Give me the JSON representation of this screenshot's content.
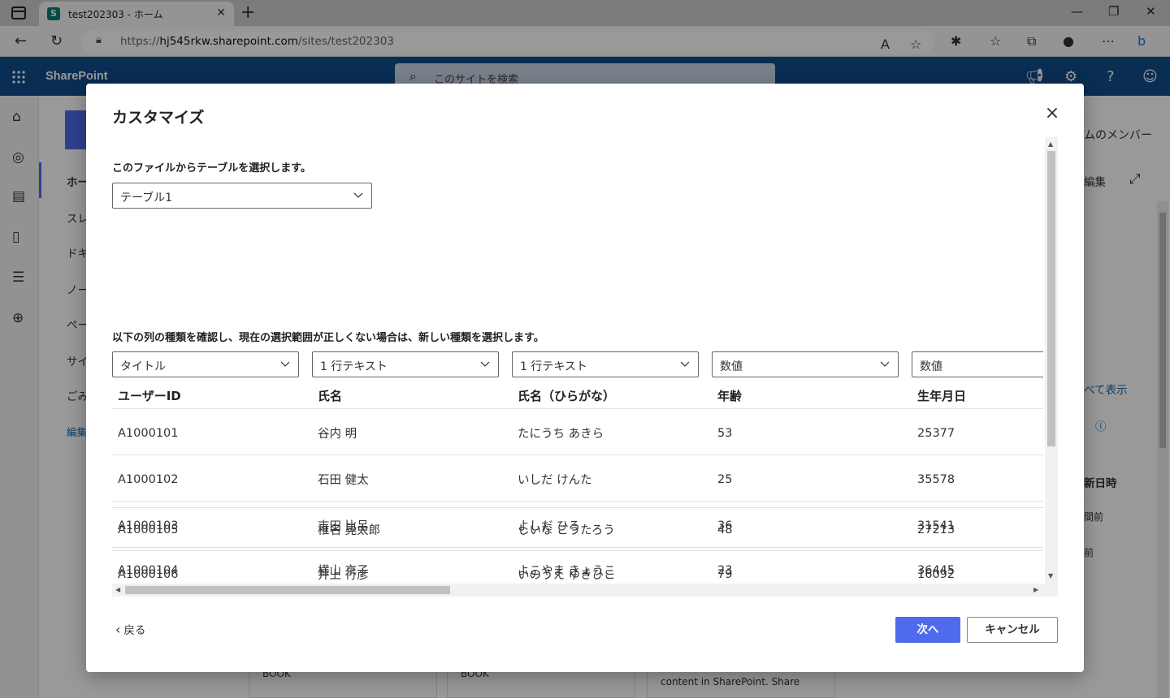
{
  "browser": {
    "tab_title": "test202303 - ホーム",
    "url_prefix": "https://",
    "url_host": "hj545rkw.sharepoint.com",
    "url_path": "/sites/test202303"
  },
  "sharepoint": {
    "brand": "SharePoint",
    "search_placeholder": "このサイトを検索"
  },
  "background": {
    "nav_fragments": [
      "ホー",
      "スレ",
      "ドキ",
      "ノー",
      "ペー",
      "サイ",
      "ごみ",
      "編集"
    ],
    "right_fragments": {
      "members": "ムのメンバー",
      "edit": "編集",
      "see_all": "べて表示",
      "date_header": "新日時",
      "ago1": "間前",
      "ago2": "前"
    },
    "bottom_cards": [
      "BOOK",
      "BOOK",
      "content in SharePoint. Share"
    ]
  },
  "modal": {
    "title": "カスタマイズ",
    "table_label": "このファイルからテーブルを選択します。",
    "table_select_value": "テーブル1",
    "types_label": "以下の列の種類を確認し、現在の選択範囲が正しくない場合は、新しい種類を選択します。",
    "column_types": [
      "タイトル",
      "1 行テキスト",
      "1 行テキスト",
      "数値",
      "数値"
    ],
    "columns": [
      "ユーザーID",
      "氏名",
      "氏名（ひらがな）",
      "年齢",
      "生年月日"
    ],
    "rows": [
      [
        "A1000101",
        "谷内 明",
        "たにうち あきら",
        "53",
        "25377"
      ],
      [
        "A1000102",
        "石田 健太",
        "いしだ けんた",
        "25",
        "35578"
      ],
      [
        "A1000103",
        "吉田 比呂",
        "よしだ ひろ",
        "36",
        "31541"
      ],
      [
        "A1000104",
        "横山 京子",
        "よこやま きょうこ",
        "23",
        "36445"
      ],
      [
        "A1000105",
        "椎名 晃太郎",
        "しいな こうたろう",
        "48",
        "27213"
      ],
      [
        "A1000106",
        "井上 行彦",
        "いのうえ ゆきひこ",
        "79",
        "16092"
      ]
    ],
    "back_label": "戻る",
    "next_label": "次へ",
    "cancel_label": "キャンセル"
  }
}
